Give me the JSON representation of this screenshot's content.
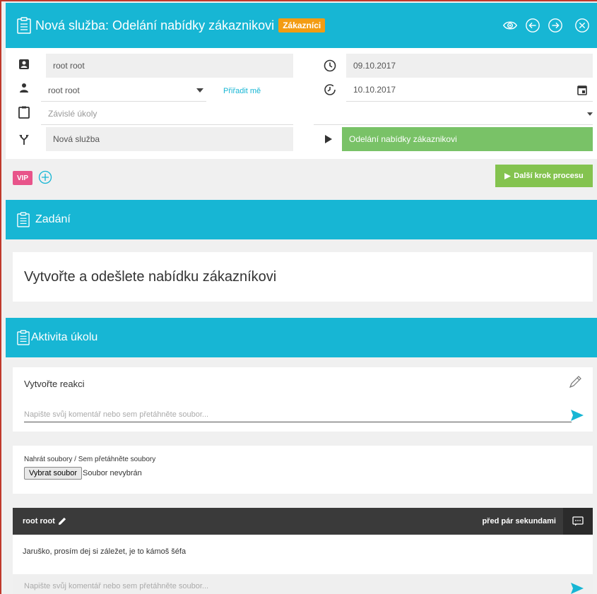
{
  "header": {
    "title": "Nová služba: Odelání nabídky zákaznikovi",
    "badge": "Zákazníci",
    "icons": [
      "eye-icon",
      "arrow-left-circle-icon",
      "arrow-right-circle-icon",
      "close-circle-icon"
    ]
  },
  "info": {
    "owner": "root root",
    "assignee": "root root",
    "assign_me": "Přiřadit mě",
    "dependent_placeholder": "Závislé úkoly",
    "process": "Nová služba",
    "start_date": "09.10.2017",
    "due_date": "10.10.2017",
    "step": "Odelání nabídky zákaznikovi"
  },
  "toolbar": {
    "vip": "VIP",
    "next_step": "Další krok procesu"
  },
  "assignment": {
    "title": "Zadání",
    "text": "Vytvořte a odešlete nabídku zákazníkovi"
  },
  "activity": {
    "title": "Aktivita úkolu",
    "reaction_title": "Vytvořte reakci",
    "comment_placeholder": "Napište svůj komentář nebo sem přetáhněte soubor...",
    "upload_label": "Nahrát soubory / Sem přetáhněte soubory",
    "choose_file": "Vybrat soubor",
    "no_file": "Soubor nevybrán"
  },
  "comment": {
    "author": "root root",
    "time": "před pár sekundami",
    "text": "Jaruško, prosím dej si záležet, je to kámoš šéfa",
    "reply_placeholder": "Napište svůj komentář nebo sem přetáhněte soubor..."
  },
  "colors": {
    "primary": "#17b6d4",
    "badge": "#f39c12",
    "vip": "#e8548a",
    "success": "#84c34f",
    "step": "#79c267",
    "dark": "#3a3a3a"
  }
}
